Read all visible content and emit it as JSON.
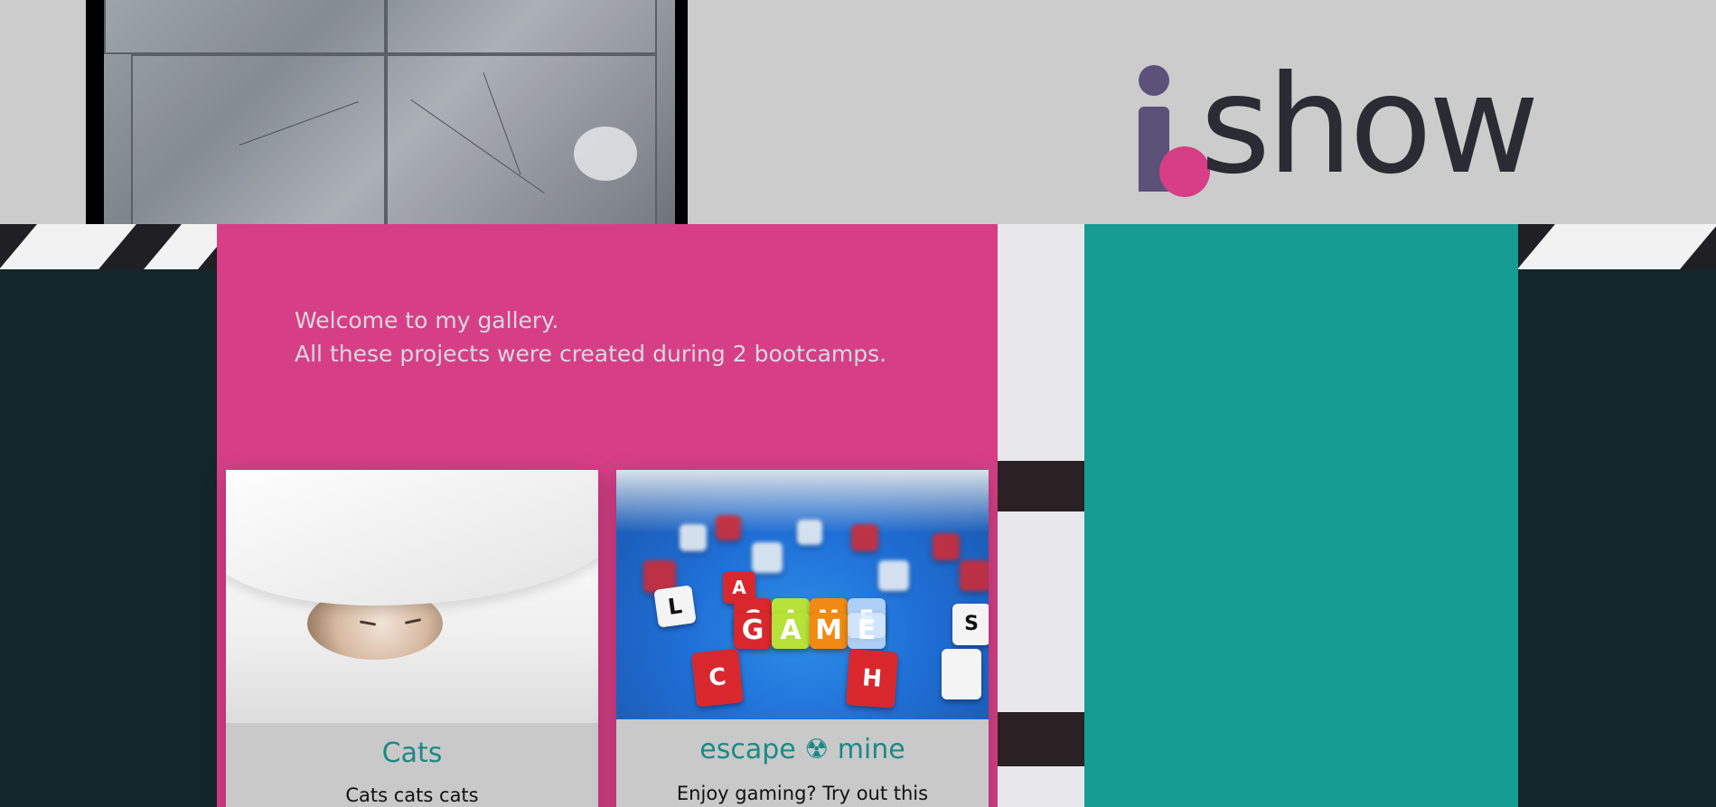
{
  "brand": {
    "wordmark": "show",
    "logo_letter": "i"
  },
  "intro": {
    "line1": "Welcome to my gallery.",
    "line2": "All these projects were created during 2 bootcamps."
  },
  "cards": [
    {
      "title": "Cats",
      "description": "Cats cats cats"
    },
    {
      "title": "escape ☢ mine",
      "description": "Enjoy gaming? Try out this"
    }
  ],
  "game_dice_text": {
    "front": [
      "G",
      "A",
      "M",
      "E"
    ],
    "back": [
      "G",
      "A",
      "M",
      "E"
    ],
    "letters": [
      "L",
      "C",
      "H",
      "S"
    ]
  },
  "colors": {
    "pink": "#d63f86",
    "teal": "#169c93",
    "logo_purple": "#5c5279",
    "card_title": "#1b8a86",
    "dark_backdrop": "#13262b",
    "header_gray": "#cccccc"
  }
}
